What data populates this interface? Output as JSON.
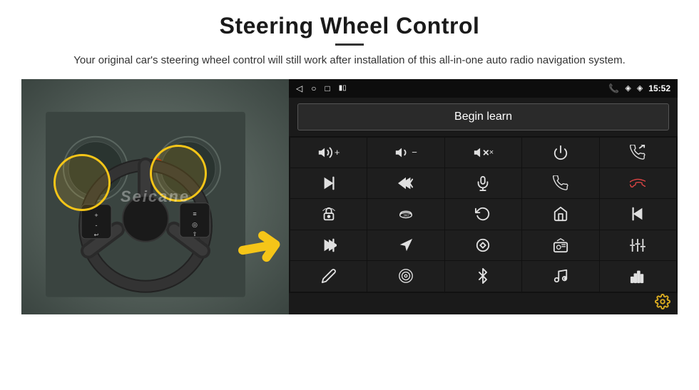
{
  "page": {
    "title": "Steering Wheel Control",
    "subtitle": "Your original car's steering wheel control will still work after installation of this all-in-one auto radio navigation system.",
    "divider_color": "#333"
  },
  "status_bar": {
    "time": "15:52",
    "back_icon": "◁",
    "home_icon": "○",
    "recents_icon": "□",
    "phone_icon": "📞",
    "location_icon": "◈",
    "wifi_icon": "◈",
    "signal_icon": "▮▮"
  },
  "begin_learn": {
    "label": "Begin learn"
  },
  "grid_buttons": [
    {
      "id": "vol-up",
      "icon": "vol_up",
      "label": "Volume Up"
    },
    {
      "id": "vol-down",
      "icon": "vol_down",
      "label": "Volume Down"
    },
    {
      "id": "vol-mute",
      "icon": "vol_mute",
      "label": "Mute"
    },
    {
      "id": "power",
      "icon": "power",
      "label": "Power"
    },
    {
      "id": "phone-end-right",
      "icon": "phone_end_right",
      "label": "Phone End"
    },
    {
      "id": "skip-next",
      "icon": "skip_next",
      "label": "Skip Next"
    },
    {
      "id": "skip-prev-fast",
      "icon": "skip_prev_fast",
      "label": "Skip Prev Fast"
    },
    {
      "id": "mic",
      "icon": "mic",
      "label": "Microphone"
    },
    {
      "id": "phone-call",
      "icon": "phone_call",
      "label": "Phone Call"
    },
    {
      "id": "phone-end-left",
      "icon": "phone_end_left",
      "label": "Phone End Left"
    },
    {
      "id": "car-lock",
      "icon": "car_lock",
      "label": "Car Lock"
    },
    {
      "id": "360-view",
      "icon": "360",
      "label": "360 View"
    },
    {
      "id": "undo",
      "icon": "undo",
      "label": "Undo"
    },
    {
      "id": "home",
      "icon": "home",
      "label": "Home"
    },
    {
      "id": "prev-track",
      "icon": "prev_track",
      "label": "Prev Track"
    },
    {
      "id": "next-track",
      "icon": "next_track",
      "label": "Next Track"
    },
    {
      "id": "navigate",
      "icon": "navigate",
      "label": "Navigate"
    },
    {
      "id": "swap",
      "icon": "swap",
      "label": "Swap"
    },
    {
      "id": "radio",
      "icon": "radio",
      "label": "Radio"
    },
    {
      "id": "equalizer",
      "icon": "equalizer",
      "label": "Equalizer"
    },
    {
      "id": "pen",
      "icon": "pen",
      "label": "Pen"
    },
    {
      "id": "target",
      "icon": "target",
      "label": "Target"
    },
    {
      "id": "bluetooth",
      "icon": "bluetooth",
      "label": "Bluetooth"
    },
    {
      "id": "music",
      "icon": "music",
      "label": "Music"
    },
    {
      "id": "spectrum",
      "icon": "spectrum",
      "label": "Spectrum"
    }
  ],
  "settings": {
    "icon": "⚙",
    "label": "Settings"
  },
  "watermark": "Seicane"
}
